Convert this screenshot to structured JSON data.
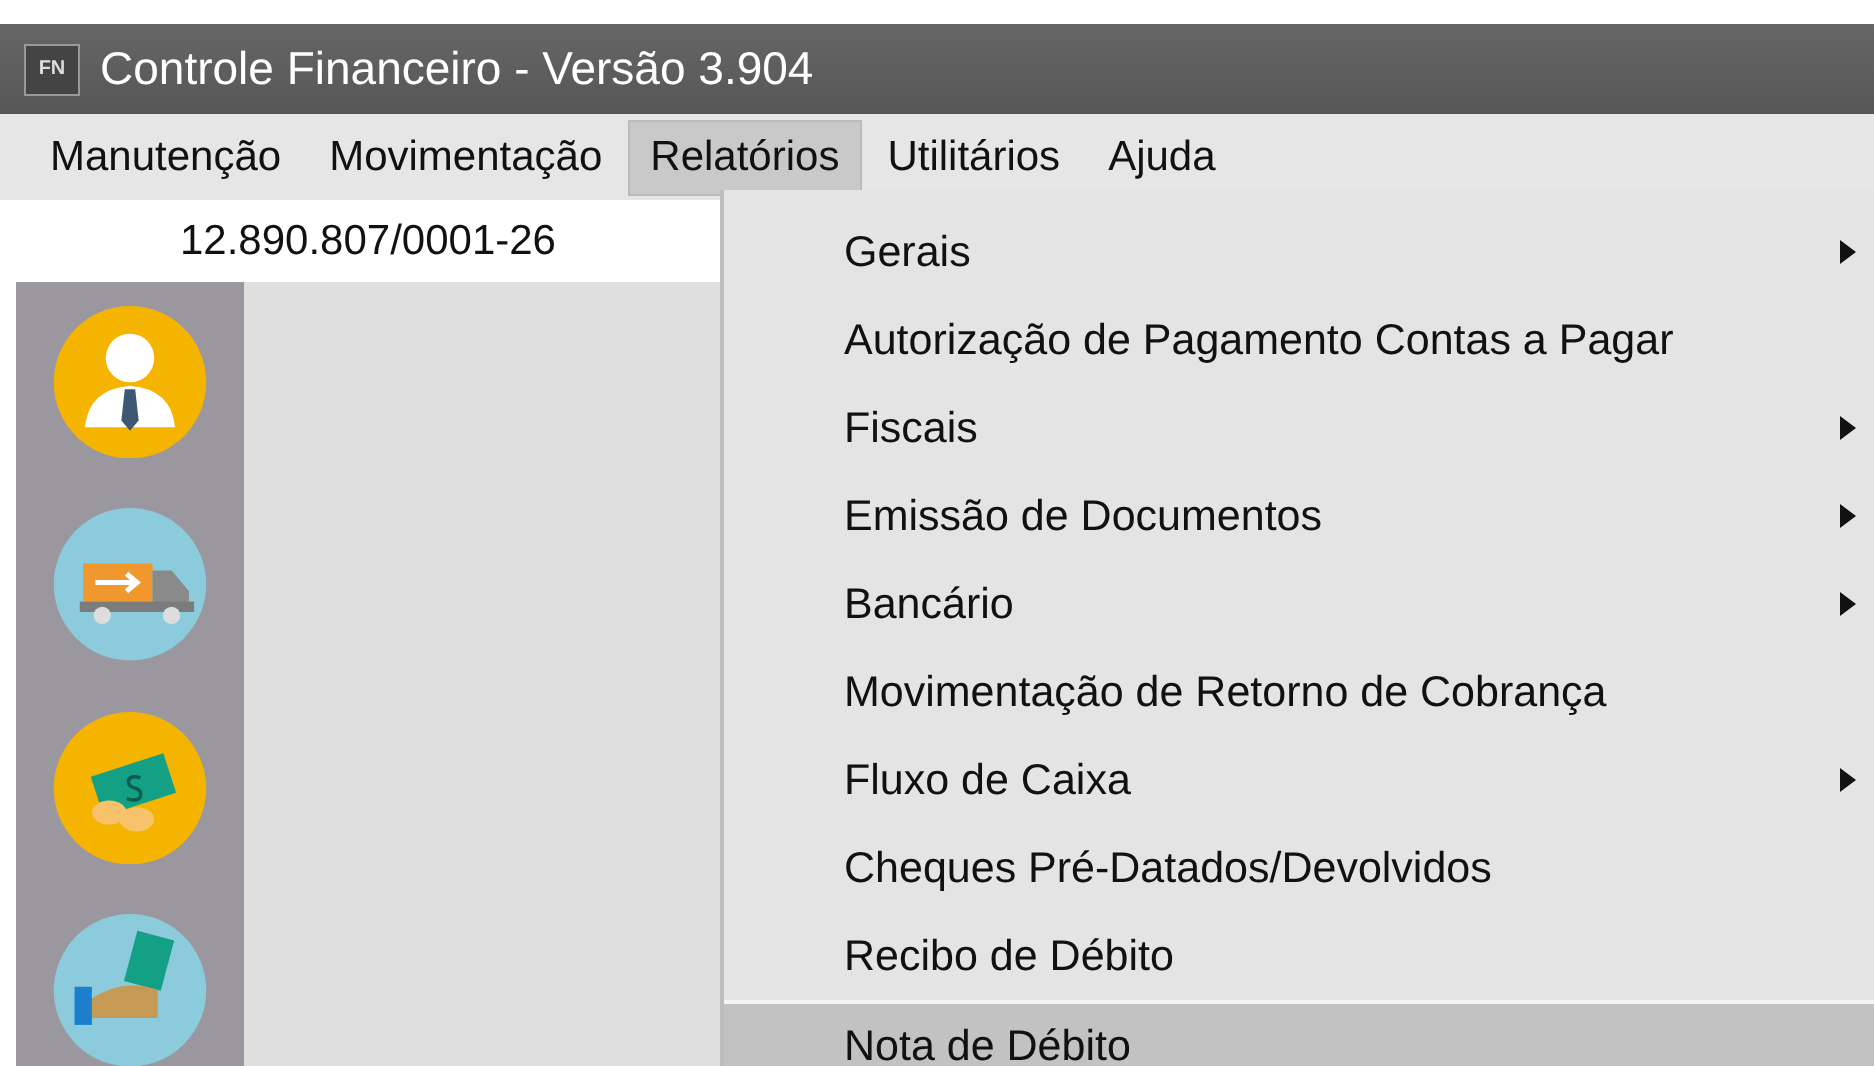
{
  "window": {
    "app_badge": "FN",
    "title": "Controle Financeiro - Versão 3.904"
  },
  "menubar": [
    {
      "label": "Manutenção",
      "selected": false
    },
    {
      "label": "Movimentação",
      "selected": false
    },
    {
      "label": "Relatórios",
      "selected": true
    },
    {
      "label": "Utilitários",
      "selected": false
    },
    {
      "label": "Ajuda",
      "selected": false
    }
  ],
  "company_id": "12.890.807/0001-26",
  "sidebar": [
    {
      "kind": "person"
    },
    {
      "kind": "truck"
    },
    {
      "kind": "money"
    },
    {
      "kind": "hand"
    }
  ],
  "dropdown": [
    {
      "label": "Gerais",
      "submenu": true,
      "selected": false
    },
    {
      "label": "Autorização de Pagamento Contas a Pagar",
      "submenu": false,
      "selected": false
    },
    {
      "label": "Fiscais",
      "submenu": true,
      "selected": false
    },
    {
      "label": "Emissão de Documentos",
      "submenu": true,
      "selected": false
    },
    {
      "label": "Bancário",
      "submenu": true,
      "selected": false
    },
    {
      "label": "Movimentação de Retorno de Cobrança",
      "submenu": false,
      "selected": false
    },
    {
      "label": "Fluxo de Caixa",
      "submenu": true,
      "selected": false
    },
    {
      "label": "Cheques Pré-Datados/Devolvidos",
      "submenu": false,
      "selected": false
    },
    {
      "label": "Recibo de Débito",
      "submenu": false,
      "selected": false
    },
    {
      "label": "Nota de Débito",
      "submenu": false,
      "selected": true
    }
  ]
}
